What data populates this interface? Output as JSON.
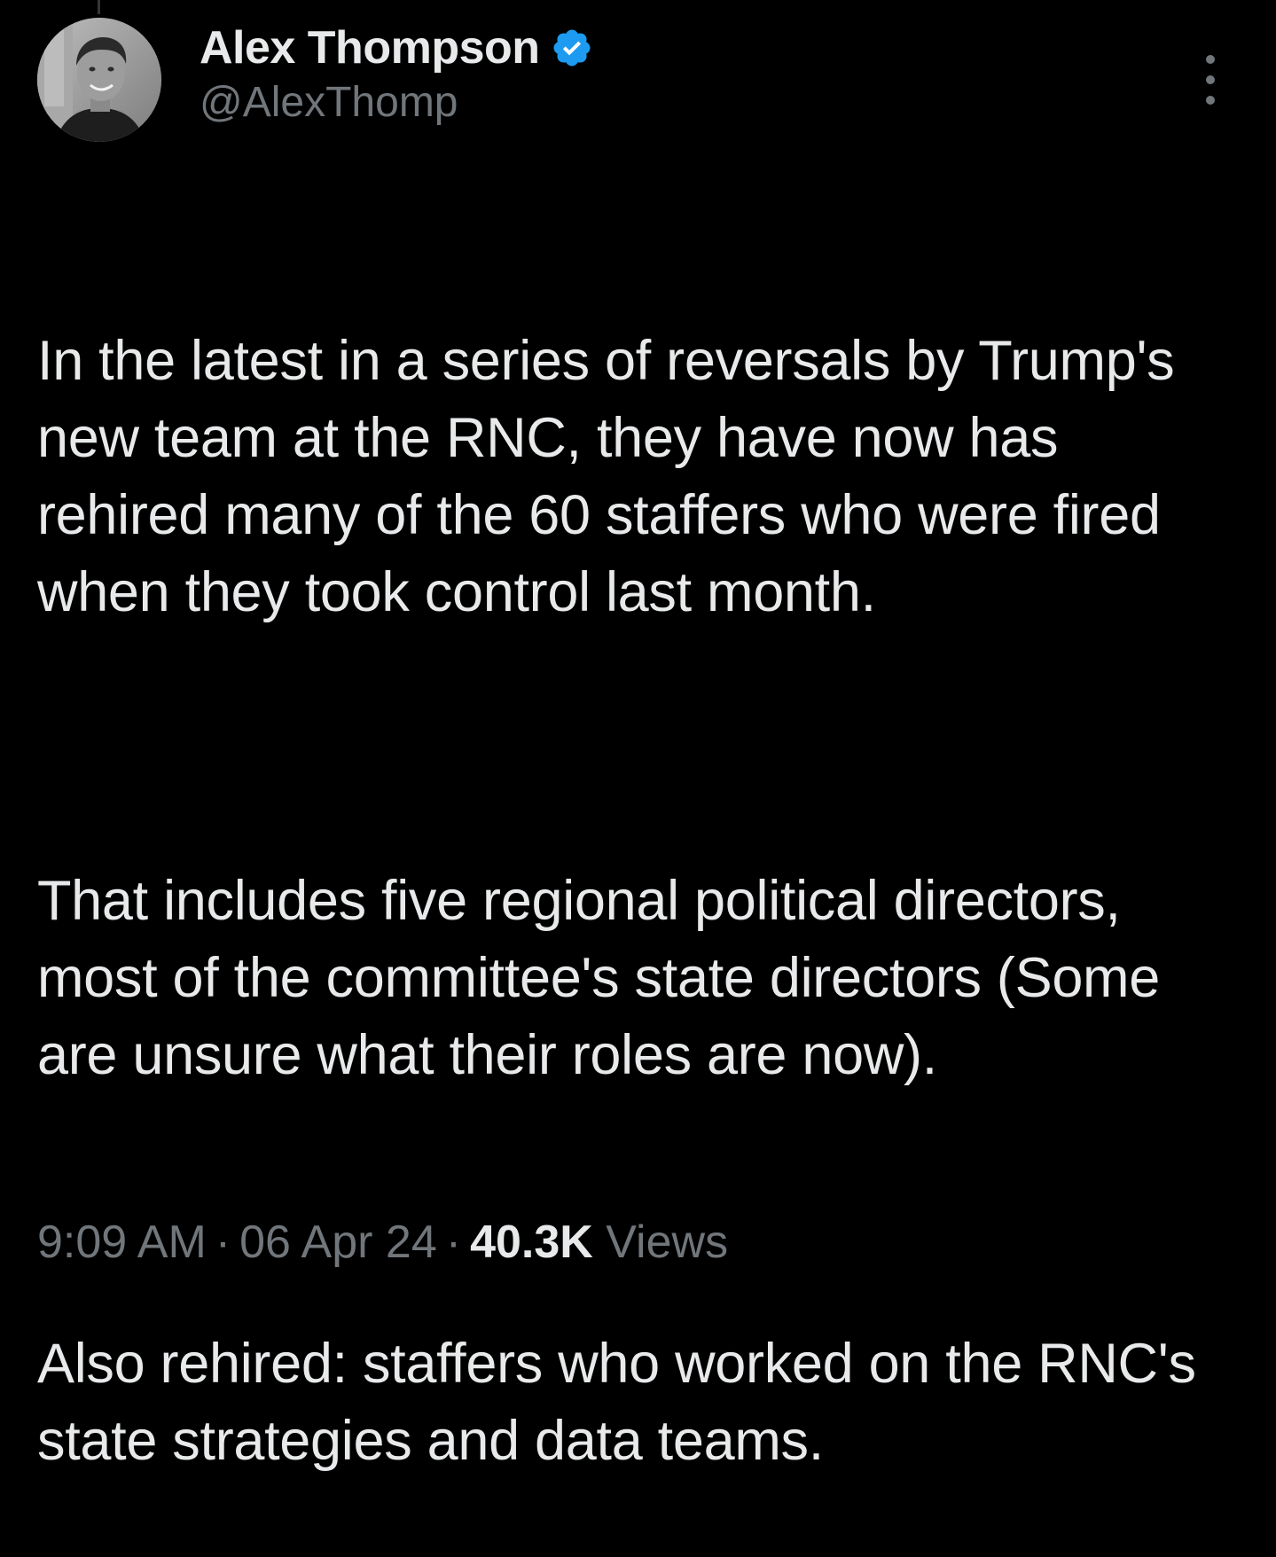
{
  "author": {
    "display_name": "Alex Thompson",
    "handle": "@AlexThomp",
    "verified": true,
    "verified_color": "#1d9bf0",
    "avatar_icon": "profile-photo"
  },
  "tweet": {
    "paragraphs": [
      "In the latest in a series of reversals by Trump's new team at the RNC, they have now has rehired many of the 60 staffers who were fired when they took control last month.",
      "That includes five regional political directors, most of the committee's state directors (Some are unsure what their roles are now).",
      "Also rehired: staffers who worked on the RNC's state strategies and data teams."
    ]
  },
  "meta": {
    "time": "9:09 AM",
    "separator": "·",
    "date": "06 Apr 24",
    "views_count": "40.3K",
    "views_label": "Views"
  },
  "colors": {
    "background": "#000000",
    "primary_text": "#e7e9ea",
    "secondary_text": "#71767b"
  },
  "icons": {
    "more": "more-vertical-icon",
    "verified": "verified-badge-icon"
  }
}
